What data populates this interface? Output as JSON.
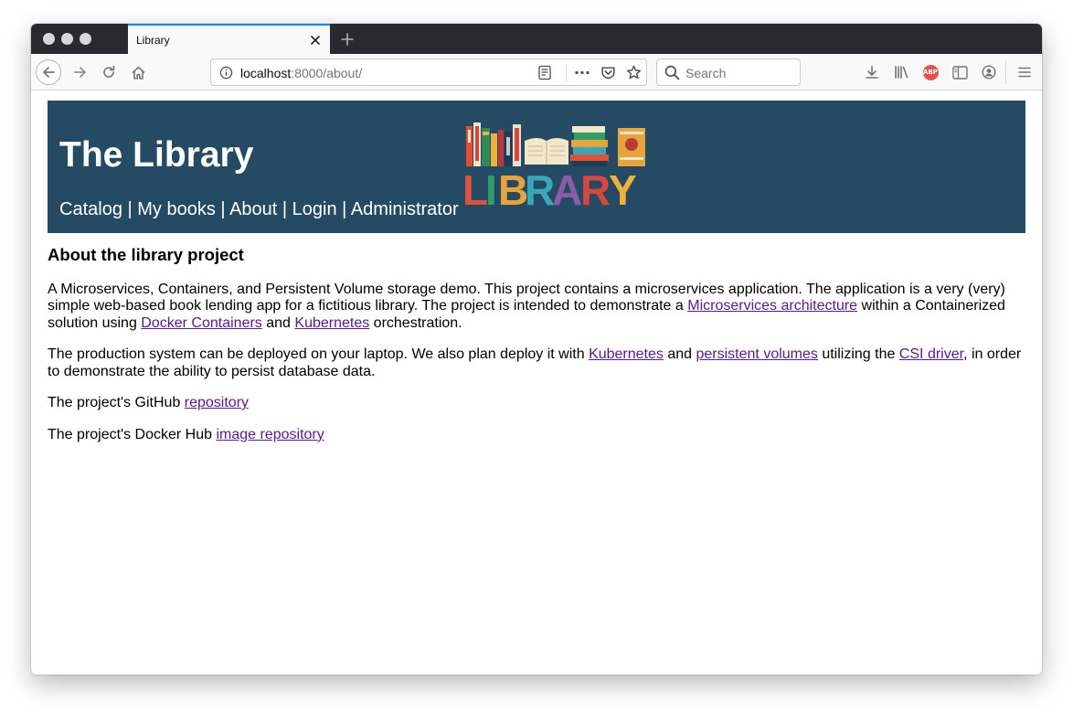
{
  "browser": {
    "tab_title": "Library",
    "url_host": "localhost",
    "url_rest": ":8000/about/",
    "search_placeholder": "Search",
    "abp_label": "ABP",
    "icons": [
      "back-icon",
      "forward-icon",
      "reload-icon",
      "home-icon",
      "info-icon",
      "reader-view-icon",
      "more-actions-icon",
      "pocket-icon",
      "bookmark-star-icon",
      "search-icon",
      "download-icon",
      "library-icon",
      "adblock-plus-icon",
      "sidebar-icon",
      "account-icon",
      "menu-icon",
      "close-icon",
      "plus-icon"
    ],
    "accent_color": "#0a84ff"
  },
  "site": {
    "title": "The Library",
    "banner_color": "#254a63",
    "logo_text": "LIBRARY",
    "logo_colors": [
      "#e0513a",
      "#2e9e6b",
      "#e8a33b",
      "#3aa6b9",
      "#8b5ca8",
      "#d9453f",
      "#f0b13b"
    ],
    "nav": {
      "catalog": "Catalog",
      "my_books": "My books",
      "about": "About",
      "login": "Login",
      "administrator": "Administrator",
      "separator": "|"
    }
  },
  "about": {
    "heading": "About the library project",
    "p1": {
      "t1": "A Microservices, Containers, and Persistent Volume storage demo. This project contains a microservices application. The application is a very (very) simple web-based book lending app for a fictitious library. The project is intended to demonstrate a ",
      "link1": "Microservices architecture",
      "t2": " within a Containerized solution using ",
      "link2": "Docker Containers",
      "t3": " and ",
      "link3": "Kubernetes",
      "t4": " orchestration."
    },
    "p2": {
      "t1": "The production system can be deployed on your laptop. We also plan deploy it with ",
      "link1": "Kubernetes",
      "t2": " and ",
      "link2": "persistent volumes",
      "t3": " utilizing the ",
      "link3": "CSI driver",
      "t4": ", in order to demonstrate the ability to persist database data."
    },
    "p3": {
      "t1": "The project's GitHub ",
      "link1": "repository"
    },
    "p4": {
      "t1": "The project's Docker Hub ",
      "link1": "image repository"
    },
    "link_color": "#551a8b"
  }
}
